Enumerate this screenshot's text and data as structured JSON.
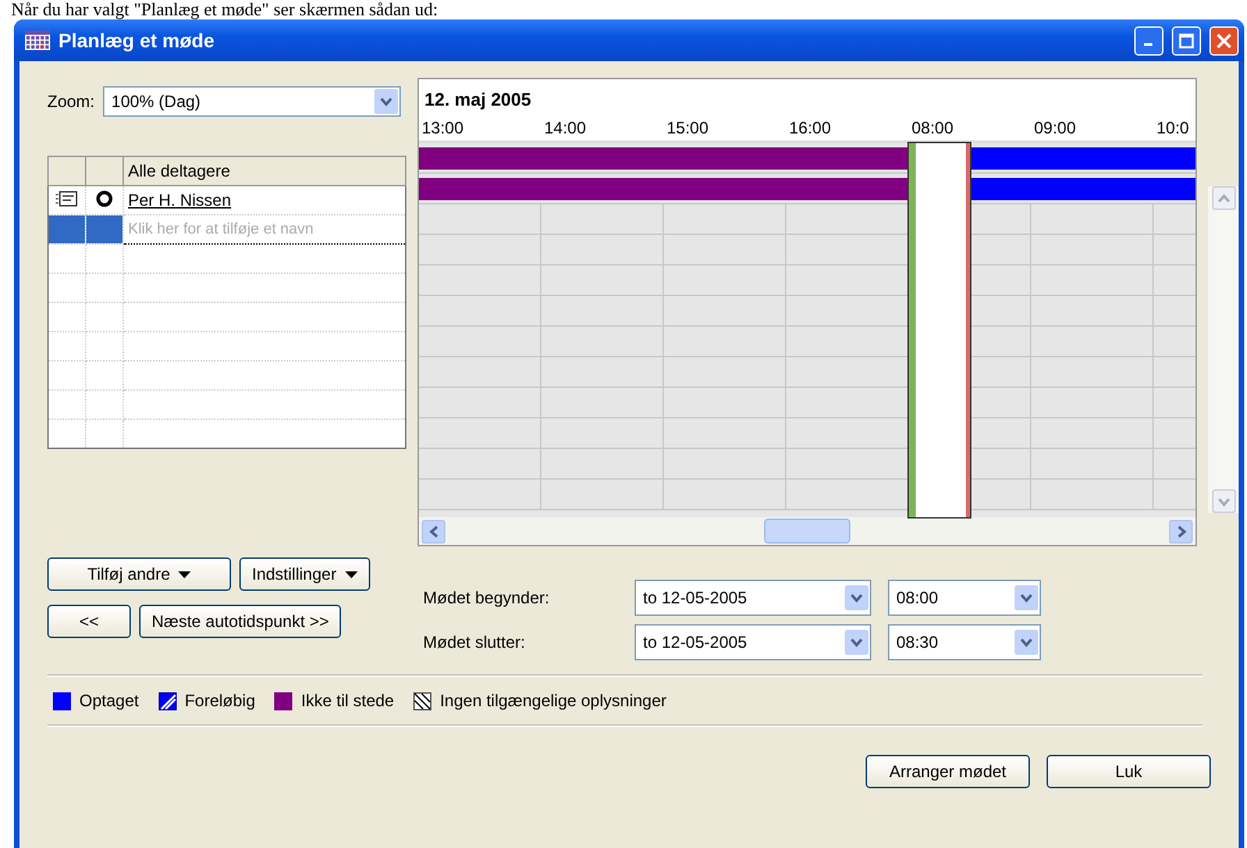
{
  "caption": "Når du har valgt \"Planlæg et møde\" ser skærmen sådan ud:",
  "window": {
    "title": "Planlæg et møde"
  },
  "zoom": {
    "label": "Zoom:",
    "value": "100% (Dag)"
  },
  "attendees": {
    "header": "Alle deltagere",
    "rows": [
      {
        "name": "Per H. Nissen",
        "statuses": [
          {
            "kind": "out_of_office"
          },
          {
            "kind": "busy"
          }
        ]
      }
    ],
    "add_placeholder": "Klik her for at tilføje et navn"
  },
  "timeline": {
    "days": [
      {
        "hours": [
          "13:00",
          "14:00",
          "15:00",
          "16:00"
        ]
      },
      {
        "label": "12. maj 2005",
        "hours": [
          "08:00",
          "09:00",
          "10:0"
        ]
      }
    ],
    "summary_statuses": [
      {
        "kind": "out_of_office"
      },
      {
        "kind": "busy"
      }
    ]
  },
  "buttons": {
    "add_others": "Tilføj andre",
    "options": "Indstillinger",
    "prev": "<<",
    "next": "Næste autotidspunkt >>",
    "arrange": "Arranger mødet",
    "close": "Luk"
  },
  "start": {
    "label": "Mødet begynder:",
    "date": "to 12-05-2005",
    "time": "08:00"
  },
  "end": {
    "label": "Mødet slutter:",
    "date": "to 12-05-2005",
    "time": "08:30"
  },
  "legend": [
    {
      "kind": "busy",
      "label": "Optaget"
    },
    {
      "kind": "tentative",
      "label": "Foreløbig"
    },
    {
      "kind": "out_of_office",
      "label": "Ikke til stede"
    },
    {
      "kind": "no_info",
      "label": "Ingen tilgængelige oplysninger"
    }
  ]
}
